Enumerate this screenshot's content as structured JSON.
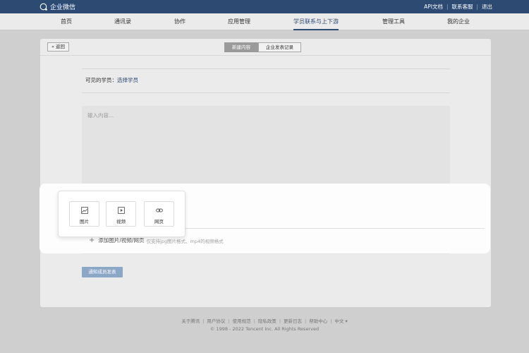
{
  "app": {
    "brand_name": "企业微信"
  },
  "top_links": [
    "API文档",
    "联系客服",
    "退出"
  ],
  "nav": {
    "items": [
      {
        "label": "首页"
      },
      {
        "label": "通讯录"
      },
      {
        "label": "协作"
      },
      {
        "label": "应用管理"
      },
      {
        "label": "学员联系与上下游"
      },
      {
        "label": "管理工具"
      },
      {
        "label": "我的企业"
      }
    ],
    "active": "学员联系与上下游"
  },
  "card": {
    "back_label": "« 返回",
    "tabs": [
      {
        "label": "新建内容"
      },
      {
        "label": "企业发表记录"
      }
    ],
    "visible_label": "可见的学员：",
    "visible_action": "选择学员",
    "editor_placeholder": "输入内容...",
    "add_media_label": "添加图片/视频/网页",
    "add_media_hint": "仅支持jpg图片格式、mp4的视频格式",
    "submit_label": "通知成员发表"
  },
  "media_options": [
    {
      "label": "图片",
      "icon": "image-icon"
    },
    {
      "label": "视频",
      "icon": "video-icon"
    },
    {
      "label": "网页",
      "icon": "link-icon"
    }
  ],
  "footer": {
    "links": [
      "关于腾讯",
      "用户协议",
      "使用规范",
      "隐私政策",
      "更新日志",
      "帮助中心",
      "中文 ▾"
    ],
    "copyright": "© 1998 - 2022 Tencent Inc. All Rights Reserved"
  },
  "colors": {
    "header_bg": "#2d4a73",
    "accent": "#2d4a73",
    "submit_bg": "#8aa7c6"
  }
}
